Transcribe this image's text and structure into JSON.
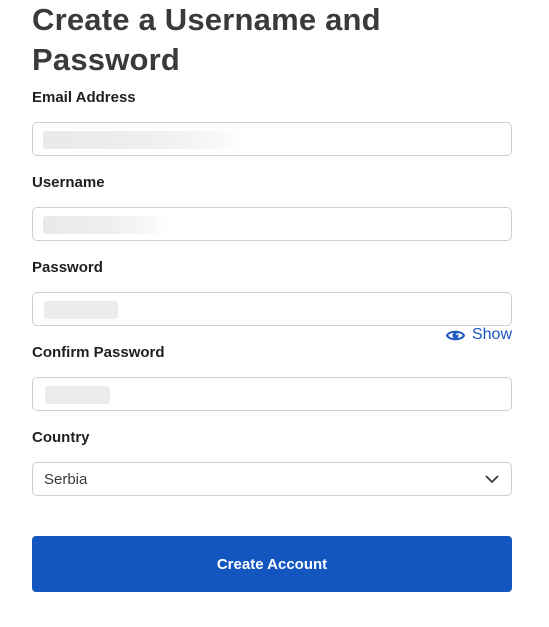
{
  "form": {
    "title": "Create a Username and Password",
    "fields": {
      "email": {
        "label": "Email Address",
        "value": ""
      },
      "username": {
        "label": "Username",
        "value": ""
      },
      "password": {
        "label": "Password",
        "value": "",
        "toggle_label": "Show",
        "toggle_icon": "eye-icon"
      },
      "confirm_password": {
        "label": "Confirm Password",
        "value": ""
      },
      "country": {
        "label": "Country",
        "selected": "Serbia",
        "icon": "chevron-down-icon"
      }
    },
    "submit_label": "Create Account"
  },
  "colors": {
    "accent": "#1456c0",
    "text_heading": "#3a3a3a",
    "border": "#d0d0d0"
  }
}
